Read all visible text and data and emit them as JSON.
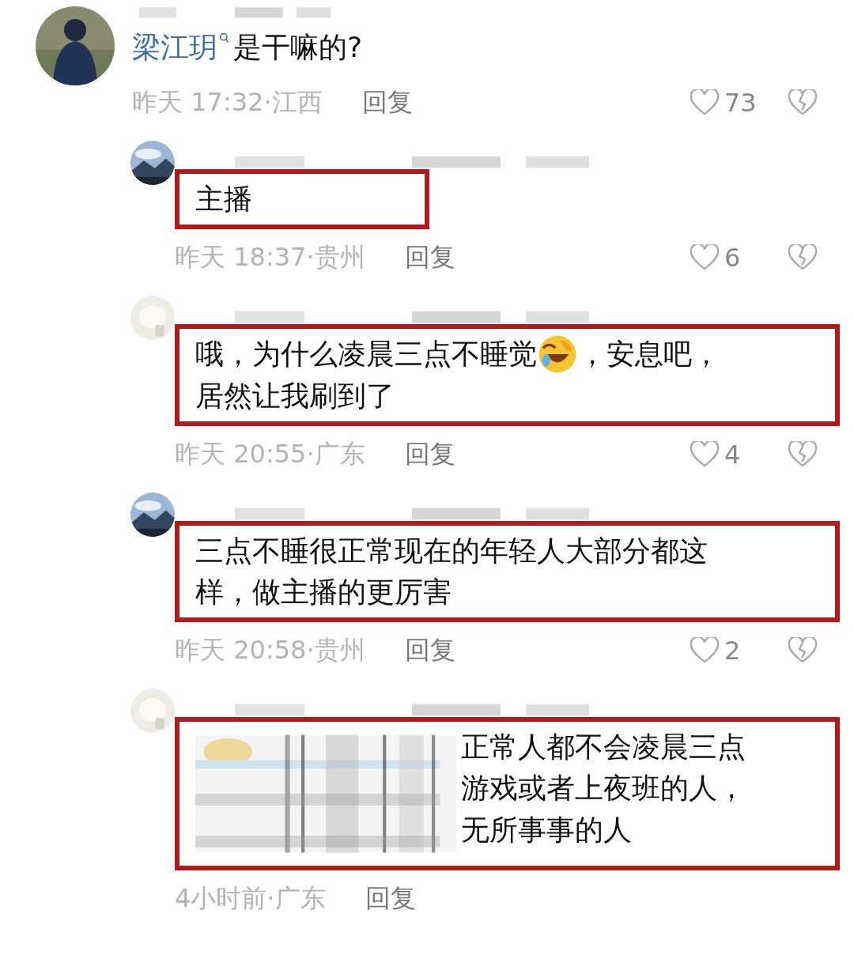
{
  "comments": [
    {
      "kind": "top",
      "mention": "梁江玥",
      "lines": [
        [
          {
            "kind": "text",
            "text": "是干嘛的?"
          }
        ]
      ],
      "highlighted": false,
      "blurred": false,
      "time": "昨天 17:32·江西",
      "reply": "回复",
      "likes": "73"
    },
    {
      "kind": "reply",
      "lines": [
        [
          {
            "kind": "text",
            "text": "主播"
          }
        ]
      ],
      "highlighted": true,
      "blurred": false,
      "time": "昨天 18:37·贵州",
      "reply": "回复",
      "likes": "6"
    },
    {
      "kind": "reply",
      "lines": [
        [
          {
            "kind": "text",
            "text": "哦，为什么凌晨三点不睡觉"
          },
          {
            "kind": "emoji"
          },
          {
            "kind": "text",
            "text": "，安息吧，"
          }
        ],
        [
          {
            "kind": "text",
            "text": "居然让我刷到了"
          }
        ]
      ],
      "highlighted": true,
      "blurred": false,
      "time": "昨天 20:55·广东",
      "reply": "回复",
      "likes": "4"
    },
    {
      "kind": "reply",
      "lines": [
        [
          {
            "kind": "text",
            "text": "三点不睡很正常现在的年轻人大部分都这"
          }
        ],
        [
          {
            "kind": "text",
            "text": "样，做主播的更厉害"
          }
        ]
      ],
      "highlighted": true,
      "blurred": false,
      "time": "昨天 20:58·贵州",
      "reply": "回复",
      "likes": "2"
    },
    {
      "kind": "reply",
      "lines": [
        [
          {
            "kind": "text",
            "text": "正常人都不会凌晨三点"
          }
        ],
        [
          {
            "kind": "text",
            "text": "游戏或者上夜班的人，"
          }
        ],
        [
          {
            "kind": "text",
            "text": "无所事事的人"
          }
        ]
      ],
      "highlighted": true,
      "blurred": true,
      "time": "4小时前·广东",
      "reply": "回复"
    }
  ]
}
